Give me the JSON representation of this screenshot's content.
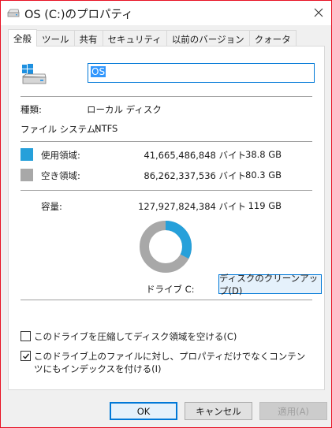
{
  "window": {
    "title": "OS (C:)のプロパティ",
    "close_glyph": "✕"
  },
  "tabs": [
    {
      "label": "全般",
      "active": true
    },
    {
      "label": "ツール"
    },
    {
      "label": "共有"
    },
    {
      "label": "セキュリティ"
    },
    {
      "label": "以前のバージョン"
    },
    {
      "label": "クォータ"
    }
  ],
  "general": {
    "volume_name": "OS",
    "type_label": "種類:",
    "type_value": "ローカル ディスク",
    "fs_label": "ファイル システム:",
    "fs_value": "NTFS",
    "used": {
      "label": "使用領域:",
      "bytes": "41,665,486,848 バイト",
      "size": "38.8 GB",
      "color": "#26a0da"
    },
    "free": {
      "label": "空き領域:",
      "bytes": "86,262,337,536 バイト",
      "size": "80.3 GB",
      "color": "#a8a8a8"
    },
    "capacity": {
      "label": "容量:",
      "bytes": "127,927,824,384 バイト",
      "size": "119 GB"
    },
    "used_fraction": 0.3257,
    "drive_label": "ドライブ C:",
    "cleanup_button": "ディスクのクリーンアップ(D)",
    "compress_checkbox": {
      "label": "このドライブを圧縮してディスク領域を空ける(C)",
      "checked": false
    },
    "index_checkbox": {
      "label": "このドライブ上のファイルに対し、プロパティだけでなくコンテンツにもインデックスを付ける(I)",
      "checked": true
    }
  },
  "buttons": {
    "ok": "OK",
    "cancel": "キャンセル",
    "apply": "適用(A)"
  }
}
